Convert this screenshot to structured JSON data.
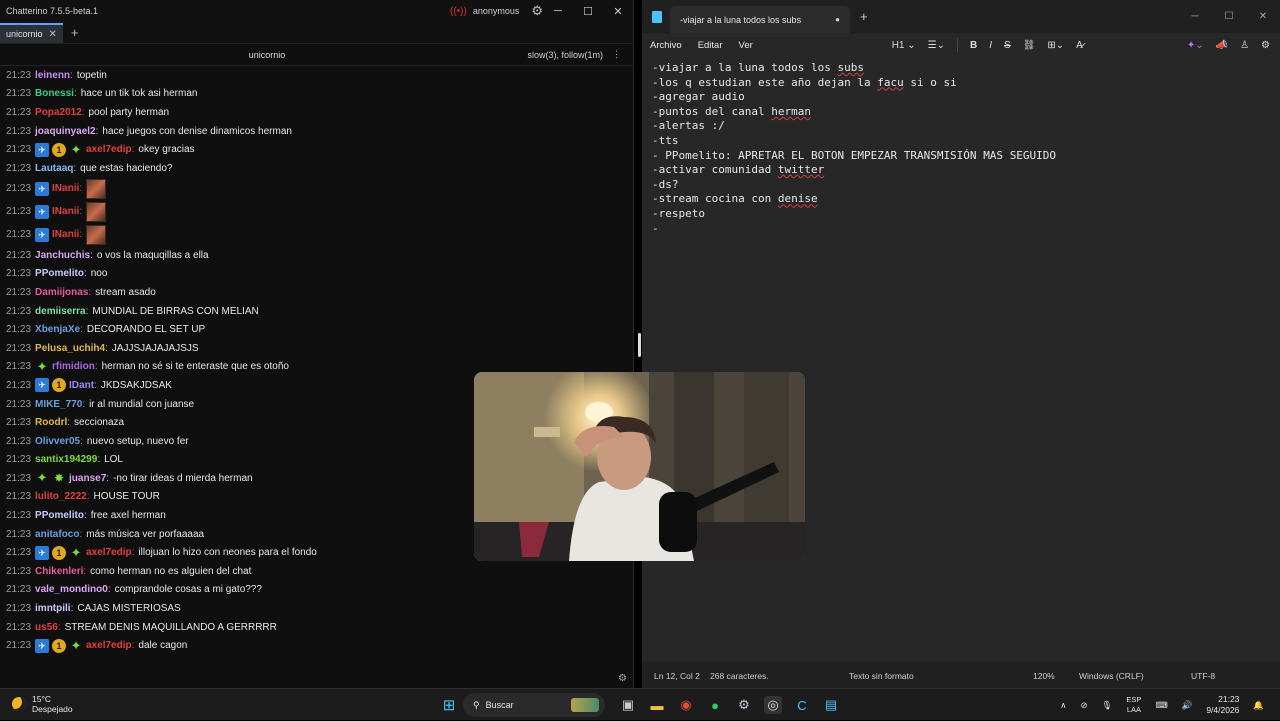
{
  "chatterino": {
    "window_title": "Chatterino 7.5.5-beta.1",
    "account": "anonymous",
    "tab": "unicornio",
    "channel": "unicornio",
    "mode": "slow(3), follow(1m)",
    "messages": [
      {
        "time": "21:23",
        "user": "leinenn",
        "color": "#c48df5",
        "text": "topetin",
        "badges": []
      },
      {
        "time": "21:23",
        "user": "Bonessi",
        "color": "#3fc98a",
        "text": "hace un tik tok asi herman",
        "badges": []
      },
      {
        "time": "21:23",
        "user": "Popa2012",
        "color": "#e0413f",
        "text": "pool party herman",
        "badges": []
      },
      {
        "time": "21:23",
        "user": "joaquinyael2",
        "color": "#d9a6f2",
        "text": "hace juegos con denise dinamicos herman",
        "badges": []
      },
      {
        "time": "21:23",
        "user": "axel7edip",
        "color": "#e0413f",
        "text": "okey gracias",
        "badges": [
          "pin",
          "sub",
          "star"
        ]
      },
      {
        "time": "21:23",
        "user": "Lautaaq",
        "color": "#8fb8f0",
        "text": "que estas haciendo?",
        "badges": []
      },
      {
        "time": "21:23",
        "user": "INanii",
        "color": "#e0413f",
        "text": "",
        "badges": [
          "pin"
        ],
        "emote": true
      },
      {
        "time": "21:23",
        "user": "INanii",
        "color": "#e0413f",
        "text": "",
        "badges": [
          "pin"
        ],
        "emote": true
      },
      {
        "time": "21:23",
        "user": "INanii",
        "color": "#e0413f",
        "text": "",
        "badges": [
          "pin"
        ],
        "emote": true
      },
      {
        "time": "21:23",
        "user": "Janchuchis",
        "color": "#d9a6f2",
        "text": "o vos la maquqillas a ella",
        "badges": []
      },
      {
        "time": "21:23",
        "user": "PPomelito",
        "color": "#c9c9ff",
        "text": "noo",
        "badges": []
      },
      {
        "time": "21:23",
        "user": "Damiijonas",
        "color": "#e65c9c",
        "text": "stream asado",
        "badges": []
      },
      {
        "time": "21:23",
        "user": "demiiserra",
        "color": "#7fe0a0",
        "text": "MUNDIAL DE BIRRAS CON MELIAN",
        "badges": []
      },
      {
        "time": "21:23",
        "user": "XbenjaXe",
        "color": "#6aa0e0",
        "text": "DECORANDO EL SET UP",
        "badges": []
      },
      {
        "time": "21:23",
        "user": "Pelusa_uchih4",
        "color": "#e0b84a",
        "text": "JAJJSJAJAJAJSJS",
        "badges": []
      },
      {
        "time": "21:23",
        "user": "rfimidion",
        "color": "#a86ae0",
        "text": "herman no sé si te enteraste que es otoño",
        "badges": [
          "star"
        ]
      },
      {
        "time": "21:23",
        "user": "IDant",
        "color": "#9a8cf0",
        "text": "JKDSAKJDSAK",
        "badges": [
          "pin",
          "sub"
        ]
      },
      {
        "time": "21:23",
        "user": "MIKE_770",
        "color": "#6aa0e0",
        "text": "ir al mundial con juanse",
        "badges": []
      },
      {
        "time": "21:23",
        "user": "Roodrl",
        "color": "#e0b84a",
        "text": "seccionaza",
        "badges": []
      },
      {
        "time": "21:23",
        "user": "Olivver05",
        "color": "#6aa0e0",
        "text": "nuevo setup, nuevo fer",
        "badges": []
      },
      {
        "time": "21:23",
        "user": "santix194299",
        "color": "#7bdc3a",
        "text": "LOL",
        "badges": []
      },
      {
        "time": "21:23",
        "user": "juanse7",
        "color": "#d9a6f2",
        "text": "-no tirar ideas d mierda herman",
        "badges": [
          "star",
          "shield"
        ]
      },
      {
        "time": "21:23",
        "user": "lulito_2222",
        "color": "#e0413f",
        "text": "HOUSE TOUR",
        "badges": []
      },
      {
        "time": "21:23",
        "user": "PPomelito",
        "color": "#c9c9ff",
        "text": "free axel herman",
        "badges": []
      },
      {
        "time": "21:23",
        "user": "anitafoco",
        "color": "#6aa0e0",
        "text": "más música ver porfaaaaa",
        "badges": []
      },
      {
        "time": "21:23",
        "user": "axel7edip",
        "color": "#e0413f",
        "text": "illojuan lo hizo con neones para el fondo",
        "badges": [
          "pin",
          "sub",
          "star"
        ]
      },
      {
        "time": "21:23",
        "user": "Chikenleri",
        "color": "#e65c9c",
        "text": "como herman no es alguien del chat",
        "badges": []
      },
      {
        "time": "21:23",
        "user": "vale_mondino0",
        "color": "#d9a6f2",
        "text": "comprandole cosas a mi gato???",
        "badges": []
      },
      {
        "time": "21:23",
        "user": "imntpili",
        "color": "#c9c9ff",
        "text": "CAJAS MISTERIOSAS",
        "badges": []
      },
      {
        "time": "21:23",
        "user": "us56",
        "color": "#e0413f",
        "text": "STREAM DENIS MAQUILLANDO A GERRRRR",
        "badges": []
      },
      {
        "time": "21:23",
        "user": "axel7edip",
        "color": "#e0413f",
        "text": "dale cagon",
        "badges": [
          "pin",
          "sub",
          "star"
        ]
      }
    ]
  },
  "notepad": {
    "tab_title": "-viajar a la luna todos los subs",
    "menu": [
      "Archivo",
      "Editar",
      "Ver"
    ],
    "heading_select": "H1",
    "lines": [
      "-viajar a la luna todos los subs",
      "-los q estudian este año dejan la facu si o si",
      "-agregar audio",
      "-puntos del canal herman",
      "-alertas :/",
      "-tts",
      "- PPomelito: APRETAR EL BOTON EMPEZAR TRANSMISIÓN MAS SEGUIDO",
      "-activar comunidad twitter",
      "-ds?",
      "-stream cocina con denise",
      "-respeto",
      "-"
    ],
    "status": {
      "position": "Ln 12, Col 2",
      "chars": "268 caracteres.",
      "format": "Texto sin formato",
      "zoom": "120%",
      "eol": "Windows (CRLF)",
      "encoding": "UTF-8"
    }
  },
  "taskbar": {
    "temp": "15°C",
    "weather": "Despejado",
    "search_placeholder": "Buscar",
    "lang1": "ESP",
    "lang2": "LAA",
    "time": "21:23",
    "date": "9/4/2026"
  }
}
